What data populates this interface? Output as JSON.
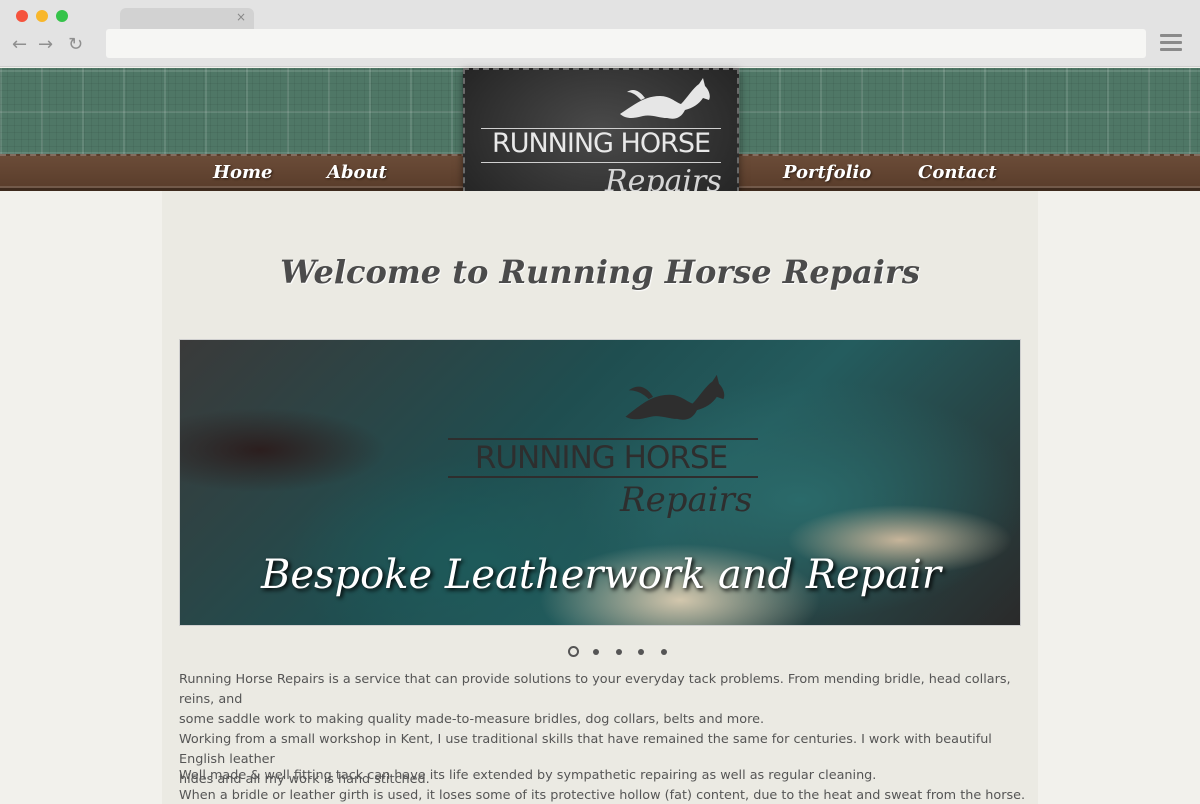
{
  "browser": {
    "tab_close": "×",
    "back_icon": "arrow-left",
    "forward_icon": "arrow-right",
    "reload_icon": "reload",
    "menu_icon": "hamburger",
    "address": ""
  },
  "nav": {
    "home": "Home",
    "about": "About",
    "portfolio": "Portfolio",
    "contact": "Contact"
  },
  "logo": {
    "title": "RUNNING HORSE",
    "subtitle": "Repairs"
  },
  "page": {
    "welcome": "Welcome to Running Horse Repairs"
  },
  "slider": {
    "logo_title": "RUNNING HORSE",
    "logo_subtitle": "Repairs",
    "caption": "Bespoke Leatherwork and Repair",
    "slide_count": 5,
    "active_slide": 1
  },
  "content": {
    "p1_line1": "Running Horse Repairs is a service that can provide solutions to your everyday tack problems. From mending bridle, head collars, reins, and",
    "p1_line2": "some saddle work to making quality made-to-measure bridles, dog collars, belts and more.",
    "p1_line3": "Working from a small workshop in Kent, I use traditional skills that have remained the same for centuries. I work with beautiful English leather",
    "p1_line4": "hides and all my work is hand stitched.",
    "p2_line1": "Well made & well fitting tack can have its life extended by sympathetic repairing as well as regular cleaning.",
    "p2_line2": "When a bridle or leather girth is used, it loses some of its protective hollow (fat) content, due to the heat and sweat from the horse. This results"
  },
  "colors": {
    "plaid": "#4f7766",
    "leather_nav": "#5a3d2b",
    "logo_bg": "#2a2a2a",
    "content_bg": "#ebeae3"
  }
}
